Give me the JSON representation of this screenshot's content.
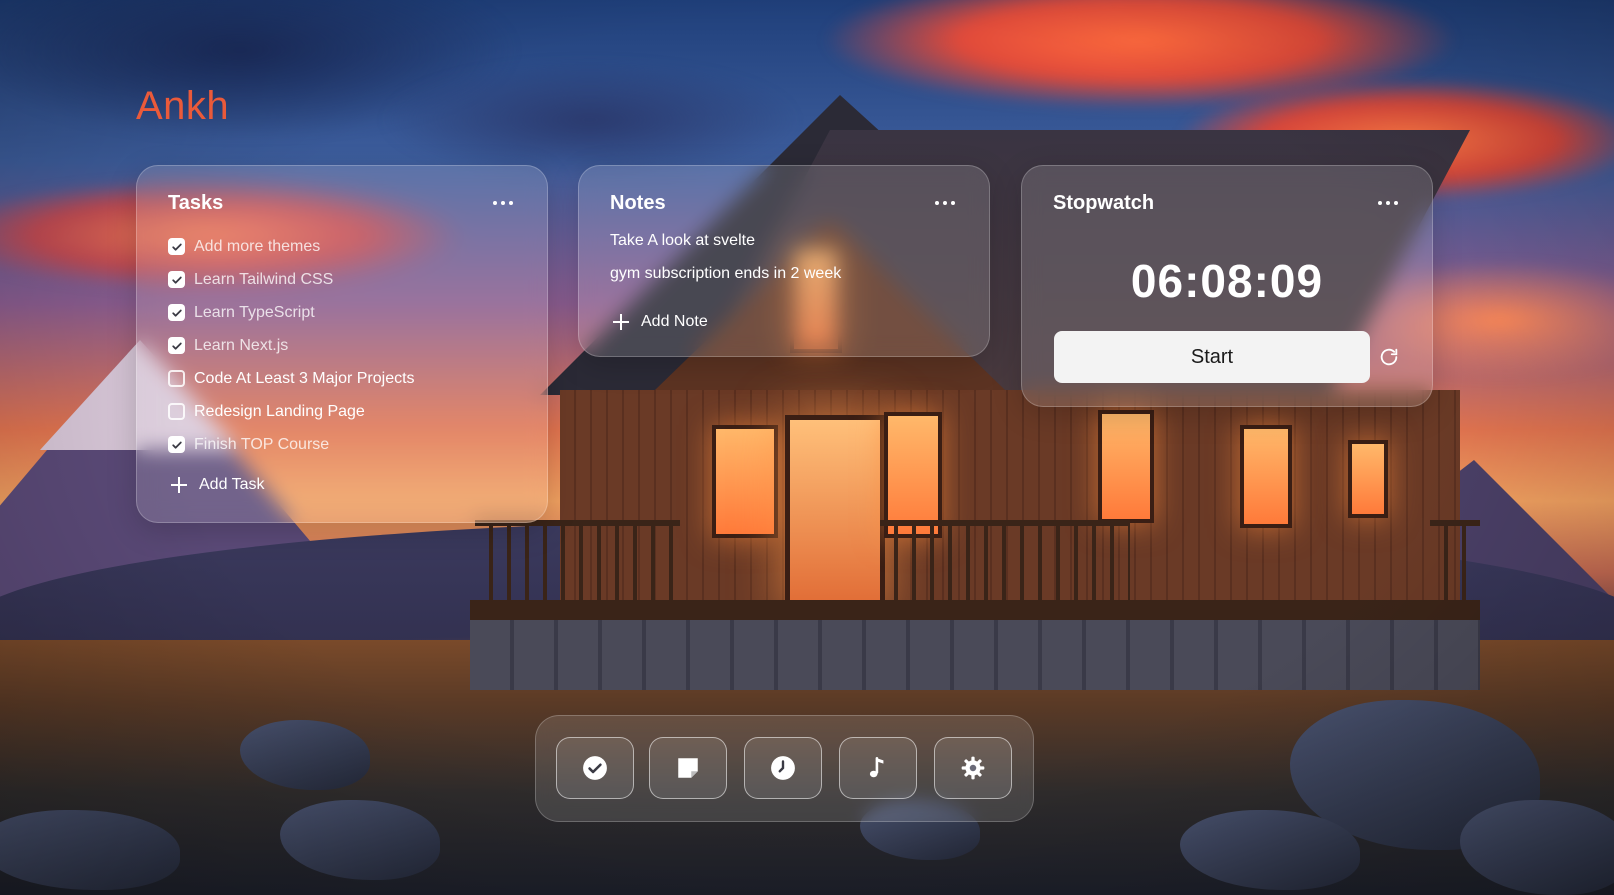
{
  "app": {
    "brand": "Ankh",
    "brand_color": "#ea5a3a"
  },
  "tasks": {
    "title": "Tasks",
    "menu_icon": "more-horizontal-icon",
    "items": [
      {
        "label": "Add more themes",
        "done": true
      },
      {
        "label": "Learn Tailwind CSS",
        "done": true
      },
      {
        "label": "Learn TypeScript",
        "done": true
      },
      {
        "label": "Learn Next.js",
        "done": true
      },
      {
        "label": "Code At Least 3 Major Projects",
        "done": false
      },
      {
        "label": "Redesign Landing Page",
        "done": false
      },
      {
        "label": "Finish TOP Course",
        "done": true
      }
    ],
    "add_label": "Add Task"
  },
  "notes": {
    "title": "Notes",
    "menu_icon": "more-horizontal-icon",
    "items": [
      "Take A look at svelte",
      "gym subscription ends in 2 week"
    ],
    "add_label": "Add Note"
  },
  "stopwatch": {
    "title": "Stopwatch",
    "menu_icon": "more-horizontal-icon",
    "time": "06:08:09",
    "start_label": "Start",
    "reset_icon": "reset-icon"
  },
  "dock": {
    "items": [
      {
        "name": "tasks",
        "icon": "check-circle-icon"
      },
      {
        "name": "notes",
        "icon": "sticky-note-icon"
      },
      {
        "name": "stopwatch",
        "icon": "clock-icon"
      },
      {
        "name": "music",
        "icon": "music-note-icon"
      },
      {
        "name": "settings",
        "icon": "gear-icon"
      }
    ]
  }
}
